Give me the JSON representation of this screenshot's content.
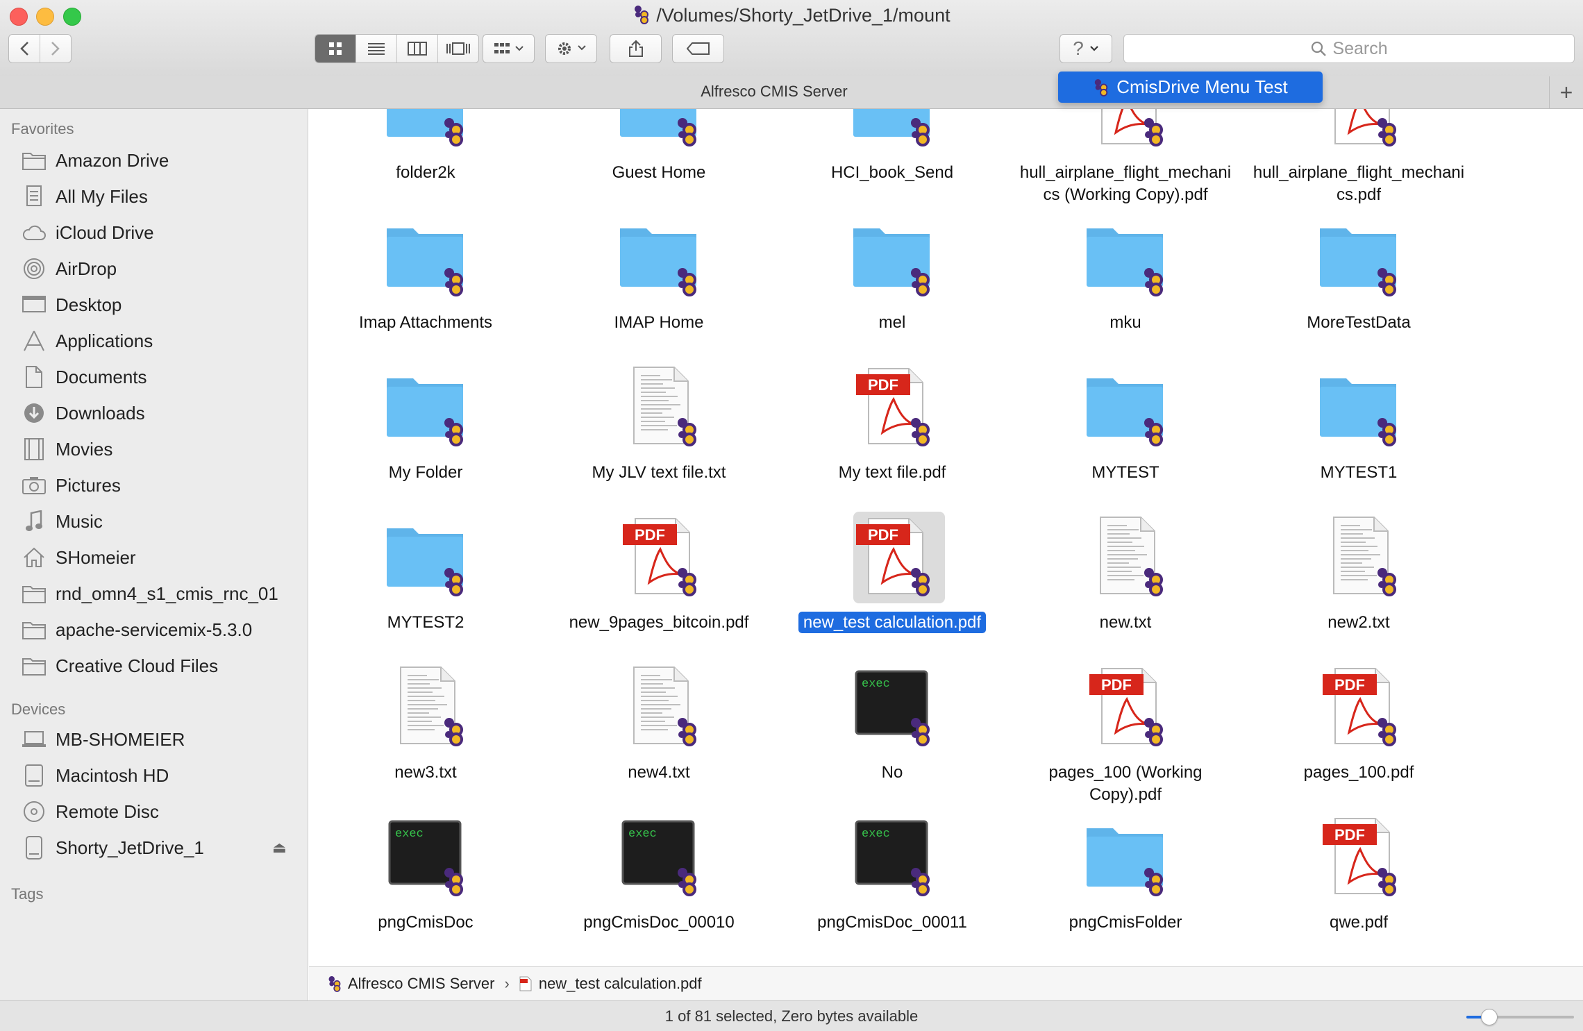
{
  "window": {
    "title": "/Volumes/Shorty_JetDrive_1/mount"
  },
  "toolbar": {
    "help_label": "?",
    "search_placeholder": "Search"
  },
  "tab": {
    "label": "Alfresco CMIS Server"
  },
  "menu": {
    "item_label": "CmisDrive Menu Test"
  },
  "sidebar": {
    "favorites_header": "Favorites",
    "favorites": [
      {
        "label": "Amazon Drive",
        "icon": "folder-icon"
      },
      {
        "label": "All My Files",
        "icon": "all-files-icon"
      },
      {
        "label": "iCloud Drive",
        "icon": "cloud-icon"
      },
      {
        "label": "AirDrop",
        "icon": "airdrop-icon"
      },
      {
        "label": "Desktop",
        "icon": "desktop-icon"
      },
      {
        "label": "Applications",
        "icon": "applications-icon"
      },
      {
        "label": "Documents",
        "icon": "documents-icon"
      },
      {
        "label": "Downloads",
        "icon": "downloads-icon"
      },
      {
        "label": "Movies",
        "icon": "film-icon"
      },
      {
        "label": "Pictures",
        "icon": "camera-icon"
      },
      {
        "label": "Music",
        "icon": "music-note-icon"
      },
      {
        "label": "SHomeier",
        "icon": "home-icon"
      },
      {
        "label": "rnd_omn4_s1_cmis_rnc_01",
        "icon": "folder-icon"
      },
      {
        "label": "apache-servicemix-5.3.0",
        "icon": "folder-icon"
      },
      {
        "label": "Creative Cloud Files",
        "icon": "folder-icon"
      }
    ],
    "devices_header": "Devices",
    "devices": [
      {
        "label": "MB-SHOMEIER",
        "icon": "laptop-icon"
      },
      {
        "label": "Macintosh HD",
        "icon": "hard-drive-icon"
      },
      {
        "label": "Remote Disc",
        "icon": "disc-icon"
      },
      {
        "label": "Shorty_JetDrive_1",
        "icon": "external-drive-icon"
      }
    ],
    "tags_header": "Tags"
  },
  "files": [
    {
      "name": "folder2k",
      "kind": "folder"
    },
    {
      "name": "Guest Home",
      "kind": "folder"
    },
    {
      "name": "HCI_book_Send",
      "kind": "folder"
    },
    {
      "name": "hull_airplane_flight_mechanics (Working Copy).pdf",
      "kind": "pdf",
      "l1": "hull_airplane_flight_mechani",
      "l2": "cs (Working Copy).pdf"
    },
    {
      "name": "hull_airplane_flight_mechanics.pdf",
      "kind": "pdf",
      "l1": "hull_airplane_flight_mechani",
      "l2": "cs.pdf"
    },
    {
      "name": "Imap Attachments",
      "kind": "folder"
    },
    {
      "name": "IMAP Home",
      "kind": "folder"
    },
    {
      "name": "mel",
      "kind": "folder"
    },
    {
      "name": "mku",
      "kind": "folder"
    },
    {
      "name": "MoreTestData",
      "kind": "folder"
    },
    {
      "name": "My Folder",
      "kind": "folder"
    },
    {
      "name": "My JLV text file.txt",
      "kind": "txt"
    },
    {
      "name": "My text file.pdf",
      "kind": "pdf"
    },
    {
      "name": "MYTEST",
      "kind": "folder"
    },
    {
      "name": "MYTEST1",
      "kind": "folder"
    },
    {
      "name": "MYTEST2",
      "kind": "folder"
    },
    {
      "name": "new_9pages_bitcoin.pdf",
      "kind": "pdf"
    },
    {
      "name": "new_test calculation.pdf",
      "kind": "pdf",
      "selected": true
    },
    {
      "name": "new.txt",
      "kind": "txt"
    },
    {
      "name": "new2.txt",
      "kind": "txt"
    },
    {
      "name": "new3.txt",
      "kind": "txt"
    },
    {
      "name": "new4.txt",
      "kind": "txt"
    },
    {
      "name": "No",
      "kind": "exec"
    },
    {
      "name": "pages_100 (Working Copy).pdf",
      "kind": "pdf",
      "l1": "pages_100 (Working",
      "l2": "Copy).pdf"
    },
    {
      "name": "pages_100.pdf",
      "kind": "pdf"
    },
    {
      "name": "pngCmisDoc",
      "kind": "exec"
    },
    {
      "name": "pngCmisDoc_00010",
      "kind": "exec"
    },
    {
      "name": "pngCmisDoc_00011",
      "kind": "exec"
    },
    {
      "name": "pngCmisFolder",
      "kind": "folder"
    },
    {
      "name": "qwe.pdf",
      "kind": "pdf"
    }
  ],
  "partial_row_kinds": [
    "txt",
    "txt",
    "txt",
    "txt",
    "folder"
  ],
  "icon_text": {
    "pdf": "PDF",
    "exec": "exec"
  },
  "pathbar": {
    "root": "Alfresco CMIS Server",
    "separator": "›",
    "file": "new_test calculation.pdf"
  },
  "status": {
    "text": "1 of 81 selected, Zero bytes available"
  },
  "colors": {
    "accent": "#1e6ce0",
    "folder": "#69c0f5",
    "pdf_red": "#d7261b",
    "cmis_purple": "#4a2a7c",
    "cmis_gold": "#f2b824"
  }
}
